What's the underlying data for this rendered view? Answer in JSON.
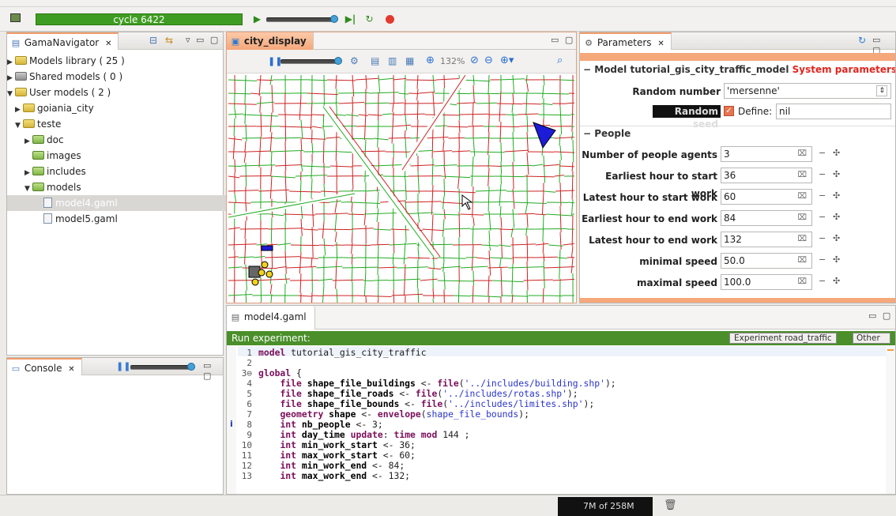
{
  "toolbar": {
    "cycle_label": "cycle 6422"
  },
  "navigator": {
    "title": "GamaNavigator",
    "items": [
      {
        "label": "Models library ( 25 )",
        "level": 0
      },
      {
        "label": "Shared models ( 0 )",
        "level": 0
      },
      {
        "label": "User models ( 2 )",
        "level": 0
      },
      {
        "label": "goiania_city",
        "level": 1
      },
      {
        "label": "teste",
        "level": 1
      },
      {
        "label": "doc",
        "level": 2
      },
      {
        "label": "images",
        "level": 2
      },
      {
        "label": "includes",
        "level": 2
      },
      {
        "label": "models",
        "level": 2
      },
      {
        "label": "model4.gaml",
        "level": 3
      },
      {
        "label": "model5.gaml",
        "level": 3
      }
    ]
  },
  "console": {
    "title": "Console"
  },
  "display": {
    "title": "city_display",
    "zoom": "132%"
  },
  "parameters": {
    "title": "Parameters",
    "model_header": "Model tutorial_gis_city_traffic_model",
    "system_params": "System parameters for",
    "rng_label": "Random number generator",
    "rng_value": "'mersenne'",
    "seed_label": "Random seed",
    "define_label": "Define:",
    "define_value": "nil",
    "people_header": "People",
    "rows": [
      {
        "label": "Number of people agents",
        "value": "3"
      },
      {
        "label": "Earliest hour to start work",
        "value": "36"
      },
      {
        "label": "Latest hour to start work",
        "value": "60"
      },
      {
        "label": "Earliest hour to end work",
        "value": "84"
      },
      {
        "label": "Latest hour to end work",
        "value": "132"
      },
      {
        "label": "minimal speed",
        "value": "50.0"
      },
      {
        "label": "maximal speed",
        "value": "100.0"
      }
    ]
  },
  "editor": {
    "title": "model4.gaml",
    "run_label": "Run experiment:",
    "exp_button": "Experiment road_traffic",
    "other_button": "Other"
  },
  "status": {
    "memory": "7M of 258M"
  },
  "colors": {
    "accent_green": "#3f9c22",
    "tab_orange": "#f5a87a",
    "road_red": "#cc2222",
    "road_green": "#22aa22"
  }
}
